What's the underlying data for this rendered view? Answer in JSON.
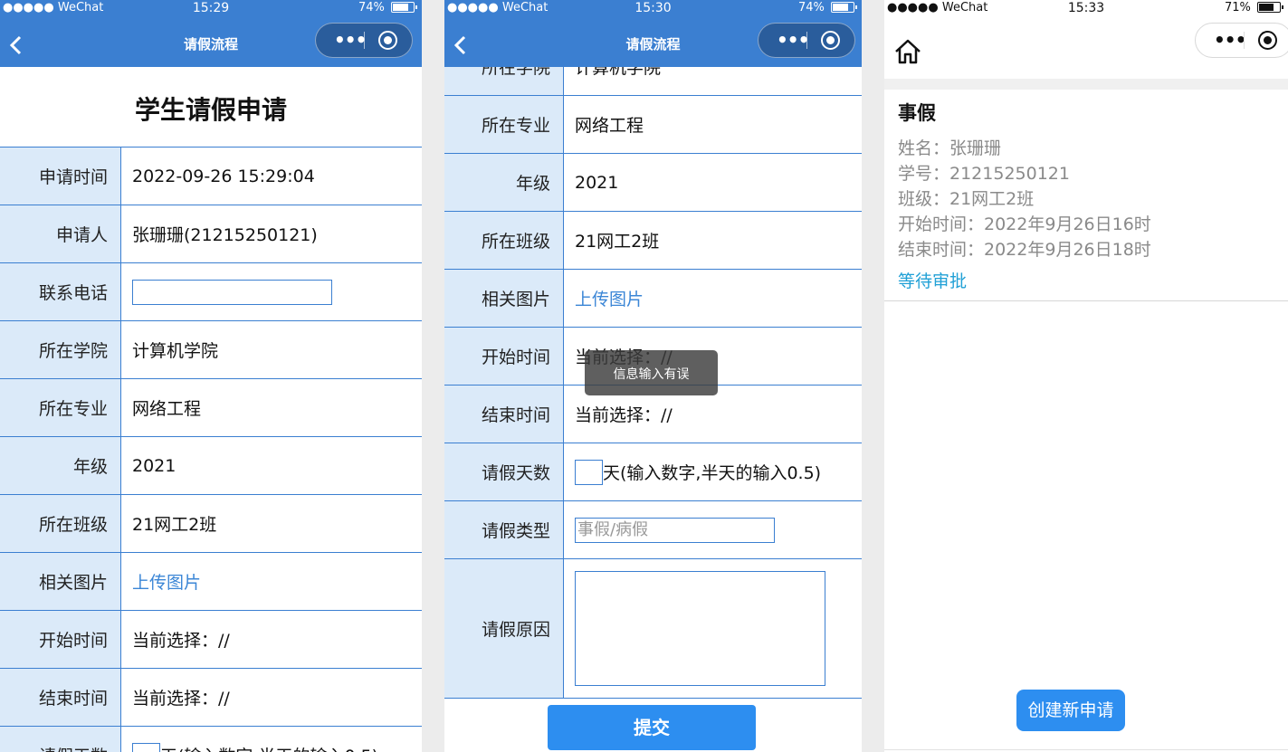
{
  "status_bar": {
    "carrier": "●●●●● WeChat",
    "panel1_time": "15:29",
    "panel1_battery": "74%",
    "panel2_time": "15:30",
    "panel2_battery": "74%",
    "panel3_time": "15:33",
    "panel3_battery": "71%",
    "icons": [
      "wifi-icon",
      "battery-icon"
    ]
  },
  "nav": {
    "title": "请假流程",
    "capsule_more": "•••",
    "icons": [
      "back-arrow-icon",
      "more-icon",
      "target-icon",
      "home-icon"
    ]
  },
  "form": {
    "heading": "学生请假申请",
    "apply_time": {
      "label": "申请时间",
      "value": "2022-09-26 15:29:04"
    },
    "applicant": {
      "label": "申请人",
      "value": "张珊珊(21215250121)"
    },
    "phone": {
      "label": "联系电话",
      "value": ""
    },
    "college": {
      "label": "所在学院",
      "value": "计算机学院"
    },
    "major": {
      "label": "所在专业",
      "value": "网络工程"
    },
    "grade": {
      "label": "年级",
      "value": "2021"
    },
    "class": {
      "label": "所在班级",
      "value": "21网工2班"
    },
    "image": {
      "label": "相关图片",
      "value": "上传图片"
    },
    "start_time": {
      "label": "开始时间",
      "value": "当前选择：//"
    },
    "end_time": {
      "label": "结束时间",
      "value": "当前选择：//"
    },
    "days": {
      "label": "请假天数",
      "hint": "天(输入数字,半天的输入0.5)"
    },
    "type": {
      "label": "请假类型",
      "placeholder": "事假/病假"
    },
    "reason": {
      "label": "请假原因",
      "value": ""
    },
    "submit_label": "提交",
    "toast": "信息输入有误"
  },
  "record": {
    "title": "事假",
    "name_line": "姓名：张珊珊",
    "id_line": "学号：21215250121",
    "class_line": "班级：21网工2班",
    "start_line": "开始时间：2022年9月26日16时",
    "end_line": "结束时间：2022年9月26日18时",
    "status": "等待审批",
    "new_button": "创建新申请"
  },
  "colors": {
    "nav_blue": "#3b7fd1",
    "label_bg": "#dbeaf9",
    "button_blue": "#2d8ef0",
    "link_blue": "#3b86d6",
    "status_cyan": "#20a0d6"
  }
}
